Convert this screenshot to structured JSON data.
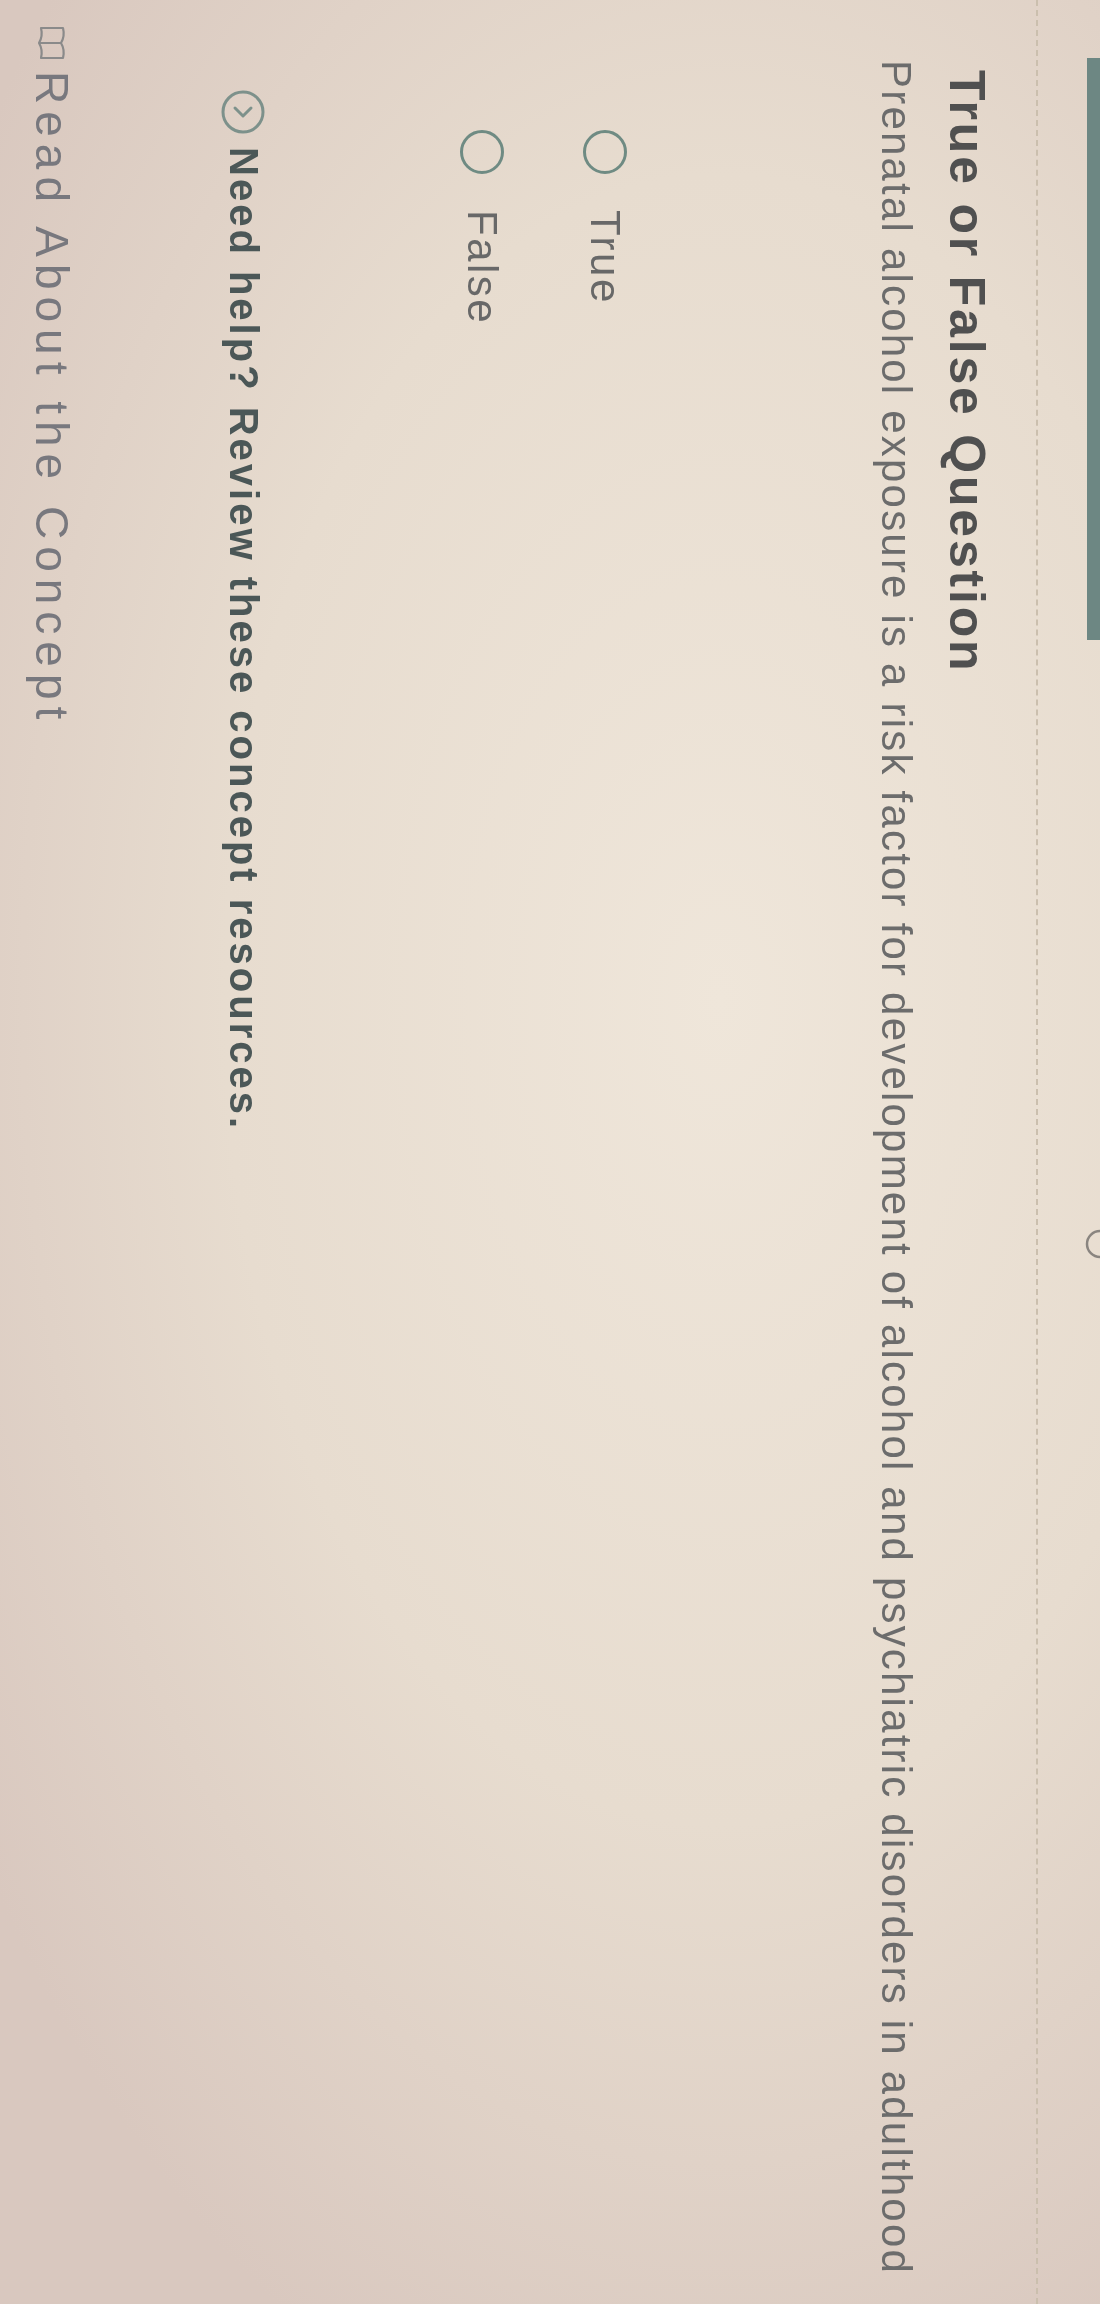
{
  "title": "True or False Question",
  "question": "Prenatal alcohol exposure is a risk factor for development of alcohol and psychiatric disorders in adulthood",
  "options": [
    {
      "label": "True",
      "selected": false
    },
    {
      "label": "False",
      "selected": false
    }
  ],
  "help": {
    "text": "Need help? Review these concept resources."
  },
  "resources": [
    {
      "label": "Read About the Concept"
    }
  ]
}
